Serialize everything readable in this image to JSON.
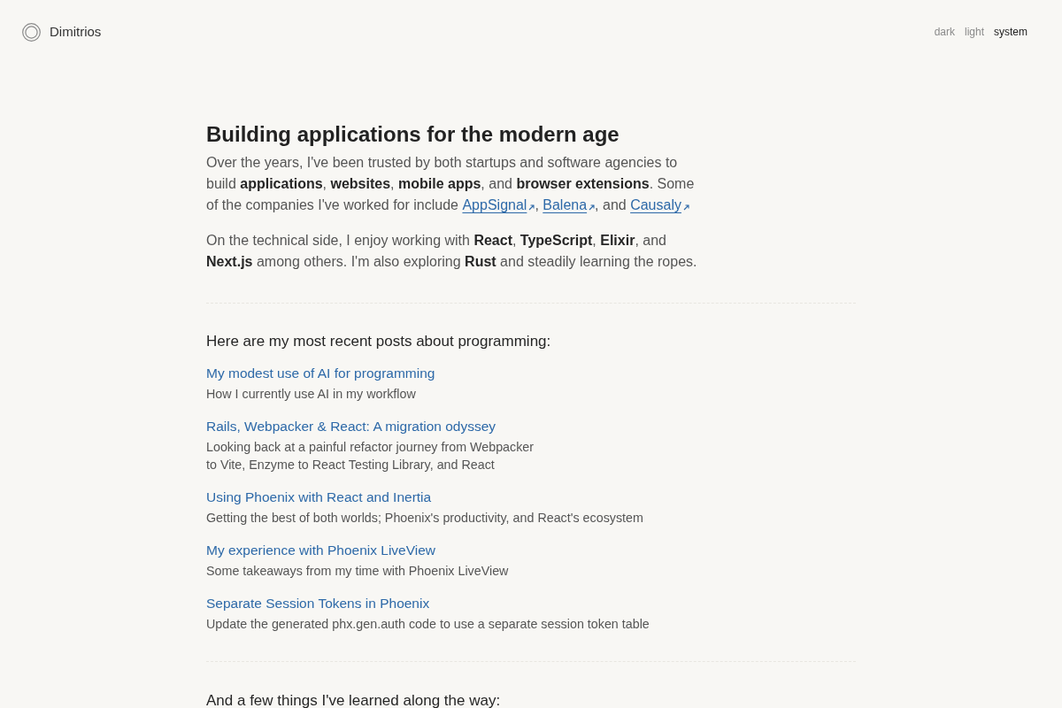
{
  "header": {
    "site_name": "Dimitrios",
    "theme_options": [
      {
        "label": "dark",
        "selected": false
      },
      {
        "label": "light",
        "selected": false
      },
      {
        "label": "system",
        "selected": true
      }
    ]
  },
  "intro": {
    "title": "Building applications for the modern age",
    "paragraphs": [
      [
        {
          "kind": "text",
          "text": "Over the years, I've been trusted by both startups and software agencies to build **applications**, **websites**, **mobile apps**, and **browser extensions**. Some of the companies I've worked for include "
        },
        {
          "kind": "link",
          "text": "AppSignal"
        },
        {
          "kind": "text",
          "text": ", "
        },
        {
          "kind": "link",
          "text": "Balena"
        },
        {
          "kind": "text",
          "text": ", and "
        },
        {
          "kind": "link",
          "text": "Causaly"
        }
      ],
      [
        {
          "kind": "text",
          "text": "On the technical side, I enjoy working with **React**, **TypeScript**, **Elixir**, and **Next.js** among others. I'm also exploring **Rust** and steadily learning the ropes."
        }
      ]
    ]
  },
  "posts_section": {
    "heading": "Here are my most recent posts about programming:",
    "posts": [
      {
        "title": "My modest use of AI for programming",
        "description": "How I currently use AI in my workflow"
      },
      {
        "title": "Rails, Webpacker & React: A migration odyssey",
        "description": "Looking back at a painful refactor journey from Webpacker\nto Vite, Enzyme to React Testing Library, and React"
      },
      {
        "title": "Using Phoenix with React and Inertia",
        "description": "Getting the best of both worlds; Phoenix's productivity, and React's ecosystem"
      },
      {
        "title": "My experience with Phoenix LiveView",
        "description": "Some takeaways from my time with Phoenix LiveView"
      },
      {
        "title": "Separate Session Tokens in Phoenix",
        "description": "Update the generated phx.gen.auth code to use a separate session token table"
      }
    ]
  },
  "learnings_section": {
    "heading": "And a few things I've learned along the way:"
  }
}
